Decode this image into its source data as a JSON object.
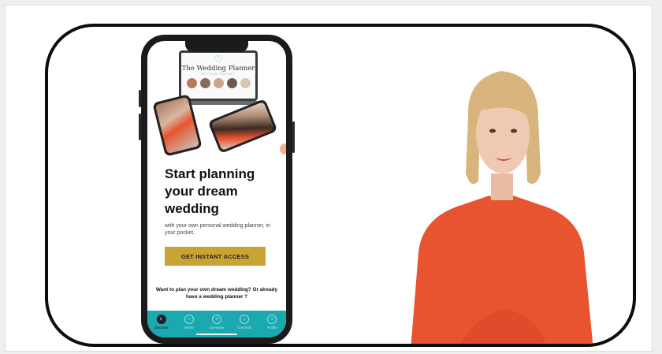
{
  "phone": {
    "laptop_title": "The Wedding Planner",
    "laptop_subtitle": "IN YOUR POCKET",
    "headline": "Start planning your dream wedding",
    "subtext": "with your own personal wedding planner, in your pocket.",
    "cta_label": "GET INSTANT ACCESS",
    "question": "Want to plan your own dream wedding? Or already have a wedding planner ?",
    "tabs": [
      {
        "label": "Discover",
        "icon": "compass-icon",
        "glyph": "◐"
      },
      {
        "label": "Home",
        "icon": "home-icon",
        "glyph": "⌂"
      },
      {
        "label": "Overview",
        "icon": "list-icon",
        "glyph": "≡"
      },
      {
        "label": "Checklist",
        "icon": "check-icon",
        "glyph": "✓"
      },
      {
        "label": "Profile",
        "icon": "user-icon",
        "glyph": "☺"
      }
    ]
  },
  "colors": {
    "accent_teal": "#1aa9ae",
    "cta_gold": "#c9a434",
    "presenter_top": "#e8542f"
  }
}
